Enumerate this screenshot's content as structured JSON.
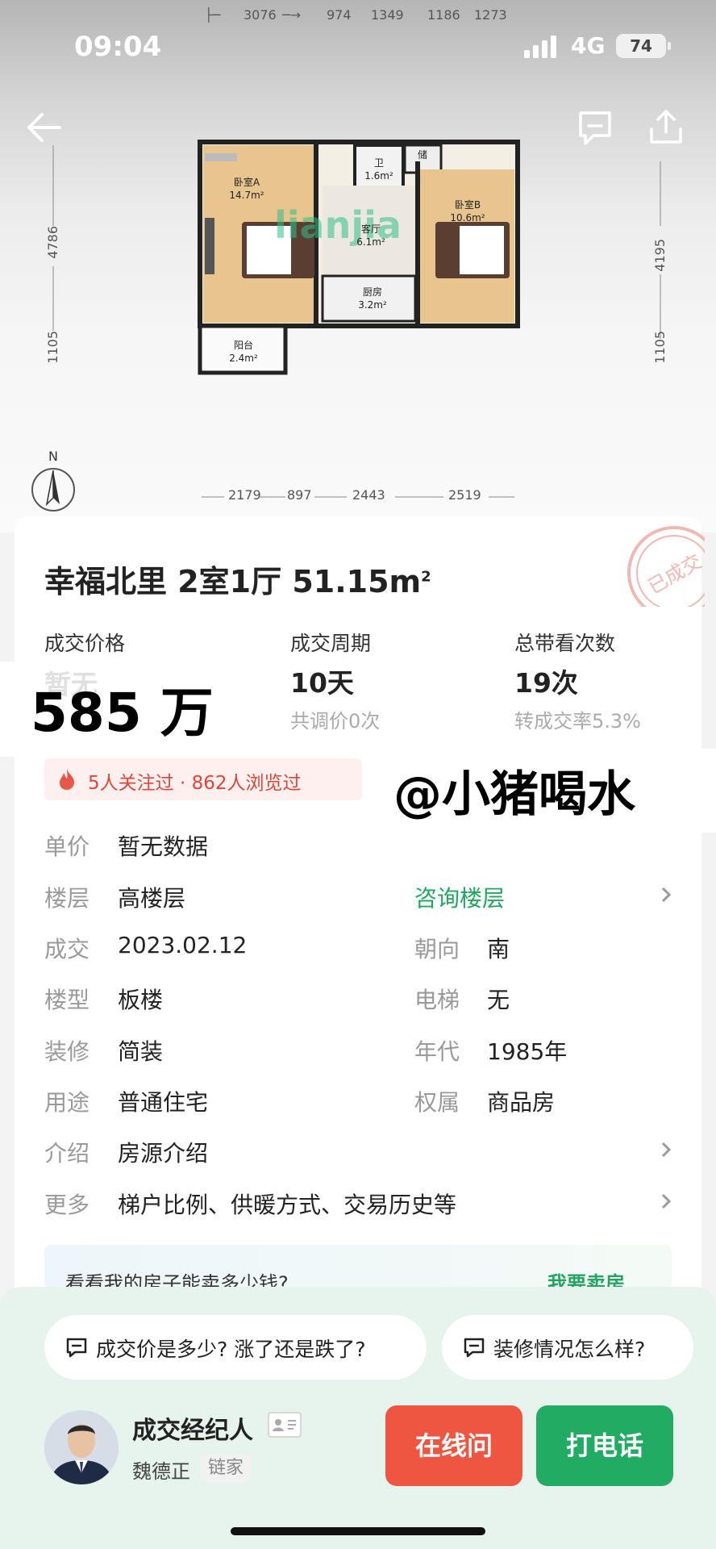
{
  "status_bar": {
    "time": "09:04",
    "network": "4G",
    "battery": "74"
  },
  "floorplan": {
    "top_dims": [
      "3076",
      "974",
      "1349",
      "1186",
      "1273"
    ],
    "bottom_dims": [
      "2179",
      "897",
      "2443",
      "2519"
    ],
    "left_dims": [
      "4786",
      "1105"
    ],
    "right_dims": [
      "4195",
      "1105"
    ],
    "rooms": [
      {
        "name": "卧室A",
        "area": "14.7m²"
      },
      {
        "name": "卫",
        "area": "1.6m²"
      },
      {
        "name": "储",
        "area": ""
      },
      {
        "name": "客厅",
        "area": "6.1m²"
      },
      {
        "name": "卧室B",
        "area": "10.6m²"
      },
      {
        "name": "厨房",
        "area": "3.2m²"
      },
      {
        "name": "阳台",
        "area": "2.4m²"
      }
    ],
    "watermark": "lianjia",
    "compass_label": "N"
  },
  "stamp_text": "已成交",
  "listing": {
    "title": "幸福北里 2室1厅 51.15㎡",
    "title_main": "幸福北里 2室1厅 51.15m",
    "title_sup": "2"
  },
  "stats": [
    {
      "label": "成交价格",
      "value": "暂无",
      "sub": ""
    },
    {
      "label": "成交周期",
      "value": "10天",
      "sub": "共调价0次"
    },
    {
      "label": "总带看次数",
      "value": "19次",
      "sub": "转成交率5.3%"
    }
  ],
  "price_overlay": "585 万",
  "popularity": "5人关注过 · 862人浏览过",
  "watermark_overlay": "@小猪喝水",
  "details": {
    "unit_price": {
      "label": "单价",
      "value": "暂无数据"
    },
    "floor": {
      "label": "楼层",
      "value": "高楼层",
      "link": "咨询楼层"
    },
    "deal_date": {
      "label": "成交",
      "value": "2023.02.12"
    },
    "orientation": {
      "label": "朝向",
      "value": "南"
    },
    "building_type": {
      "label": "楼型",
      "value": "板楼"
    },
    "elevator": {
      "label": "电梯",
      "value": "无"
    },
    "decoration": {
      "label": "装修",
      "value": "简装"
    },
    "year": {
      "label": "年代",
      "value": "1985年"
    },
    "usage": {
      "label": "用途",
      "value": "普通住宅"
    },
    "ownership": {
      "label": "权属",
      "value": "商品房"
    },
    "intro": {
      "label": "介绍",
      "value": "房源介绍"
    },
    "more": {
      "label": "更多",
      "value": "梯户比例、供暖方式、交易历史等"
    }
  },
  "sell_banner": {
    "text": "看看我的房子能卖多少钱?",
    "link": "我要卖房"
  },
  "quick_questions": [
    "成交价是多少? 涨了还是跌了?",
    "装修情况怎么样?"
  ],
  "agent": {
    "role": "成交经纪人",
    "name": "魏德正",
    "brand": "链家"
  },
  "buttons": {
    "online": "在线问",
    "call": "打电话"
  },
  "colors": {
    "accent_green": "#23a561",
    "call_green": "#22ab62",
    "online_red": "#ee5642",
    "panel_bg": "#e7f4ed"
  }
}
